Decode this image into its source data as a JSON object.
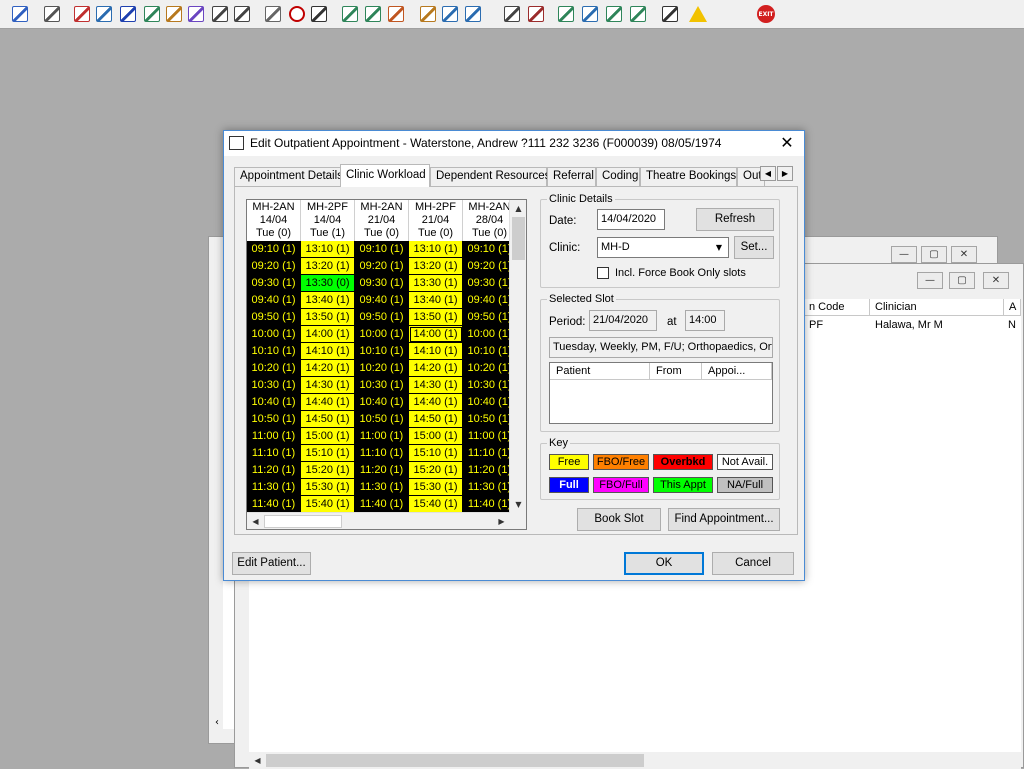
{
  "toolbar": {
    "icons": [
      "patient-icon",
      "print-icon",
      "book-icon",
      "edit-icon",
      "list-icon",
      "m-icon",
      "person-icon",
      "notes-icon",
      "chart-icon",
      "chart2-icon",
      "envelope-icon",
      "clock-icon",
      "screen-icon",
      "calendar-icon",
      "calendar2-icon",
      "refresh-icon",
      "note-icon",
      "bed-icon",
      "transfer-icon",
      "document-icon",
      "bar-chart-icon",
      "globe-icon",
      "check-icon",
      "check2-icon",
      "check3-icon",
      "swap-icon",
      "warning-icon",
      "exit-icon"
    ],
    "exit_label": "EXIT"
  },
  "background_window": {
    "columns": [
      "n Code",
      "Clinician",
      "A"
    ],
    "row": {
      "code": "PF",
      "clinician": "Halawa, Mr M",
      "extra": "N"
    }
  },
  "dialog": {
    "title": "Edit Outpatient Appointment - Waterstone, Andrew ?111 232 3236 (F000039) 08/05/1974",
    "tabs": [
      "Appointment Details",
      "Clinic Workload",
      "Dependent Resources",
      "Referral",
      "Coding",
      "Theatre Bookings",
      "Out"
    ],
    "grid": {
      "columns": [
        {
          "code": "MH-2AN",
          "date": "14/04",
          "day": "Tue  (0)",
          "color": "black",
          "slots": [
            "09:10 (1)",
            "09:20 (1)",
            "09:30 (1)",
            "09:40 (1)",
            "09:50 (1)",
            "10:00 (1)",
            "10:10 (1)",
            "10:20 (1)",
            "10:30 (1)",
            "10:40 (1)",
            "10:50 (1)",
            "11:00 (1)",
            "11:10 (1)",
            "11:20 (1)",
            "11:30 (1)",
            "11:40 (1)"
          ]
        },
        {
          "code": "MH-2PF",
          "date": "14/04",
          "day": "Tue  (1)",
          "color": "yellow",
          "slots": [
            "13:10 (1)",
            "13:20 (1)",
            "13:30 (0)",
            "13:40 (1)",
            "13:50 (1)",
            "14:00 (1)",
            "14:10 (1)",
            "14:20 (1)",
            "14:30 (1)",
            "14:40 (1)",
            "14:50 (1)",
            "15:00 (1)",
            "15:10 (1)",
            "15:20 (1)",
            "15:30 (1)",
            "15:40 (1)"
          ]
        },
        {
          "code": "MH-2AN",
          "date": "21/04",
          "day": "Tue  (0)",
          "color": "black",
          "slots": [
            "09:10 (1)",
            "09:20 (1)",
            "09:30 (1)",
            "09:40 (1)",
            "09:50 (1)",
            "10:00 (1)",
            "10:10 (1)",
            "10:20 (1)",
            "10:30 (1)",
            "10:40 (1)",
            "10:50 (1)",
            "11:00 (1)",
            "11:10 (1)",
            "11:20 (1)",
            "11:30 (1)",
            "11:40 (1)"
          ]
        },
        {
          "code": "MH-2PF",
          "date": "21/04",
          "day": "Tue  (0)",
          "color": "yellow",
          "slots": [
            "13:10 (1)",
            "13:20 (1)",
            "13:30 (1)",
            "13:40 (1)",
            "13:50 (1)",
            "14:00 (1)",
            "14:10 (1)",
            "14:20 (1)",
            "14:30 (1)",
            "14:40 (1)",
            "14:50 (1)",
            "15:00 (1)",
            "15:10 (1)",
            "15:20 (1)",
            "15:30 (1)",
            "15:40 (1)"
          ]
        },
        {
          "code": "MH-2AN",
          "date": "28/04",
          "day": "Tue  (0)",
          "color": "black",
          "slots": [
            "09:10 (1)",
            "09:20 (1)",
            "09:30 (1)",
            "09:40 (1)",
            "09:50 (1)",
            "10:00 (1)",
            "10:10 (1)",
            "10:20 (1)",
            "10:30 (1)",
            "10:40 (1)",
            "10:50 (1)",
            "11:00 (1)",
            "11:10 (1)",
            "11:20 (1)",
            "11:30 (1)",
            "11:40 (1)"
          ]
        }
      ],
      "highlight_slot": {
        "column": 1,
        "row": 2,
        "color": "green"
      },
      "selected_slot": {
        "column": 3,
        "row": 5
      }
    },
    "clinic_details": {
      "title": "Clinic Details",
      "date_label": "Date:",
      "date_value": "14/04/2020",
      "refresh_label": "Refresh",
      "clinic_label": "Clinic:",
      "clinic_value": "MH-D",
      "set_label": "Set...",
      "checkbox_label": "Incl. Force Book Only slots"
    },
    "selected_slot": {
      "title": "Selected Slot",
      "period_label": "Period:",
      "period_value": "21/04/2020",
      "at_label": "at",
      "time_value": "14:00",
      "description": "Tuesday, Weekly, PM, F/U; Orthopaedics, Ort",
      "columns": [
        "Patient",
        "From",
        "Appoi..."
      ]
    },
    "key": {
      "title": "Key",
      "items": [
        {
          "label": "Free",
          "bg": "#ffff00",
          "fg": "#000000"
        },
        {
          "label": "FBO/Free",
          "bg": "#ff8000",
          "fg": "#000000"
        },
        {
          "label": "Overbkd",
          "bg": "#ff0000",
          "fg": "#000000"
        },
        {
          "label": "Not Avail.",
          "bg": "#ffffff",
          "fg": "#000000"
        },
        {
          "label": "Full",
          "bg": "#0000ff",
          "fg": "#ffffff"
        },
        {
          "label": "FBO/Full",
          "bg": "#ff00ff",
          "fg": "#000000"
        },
        {
          "label": "This Appt",
          "bg": "#00ff00",
          "fg": "#000000"
        },
        {
          "label": "NA/Full",
          "bg": "#c0c0c0",
          "fg": "#000000"
        }
      ]
    },
    "buttons": {
      "book_slot": "Book Slot",
      "find_appointment": "Find Appointment...",
      "edit_patient": "Edit Patient...",
      "ok": "OK",
      "cancel": "Cancel"
    }
  }
}
